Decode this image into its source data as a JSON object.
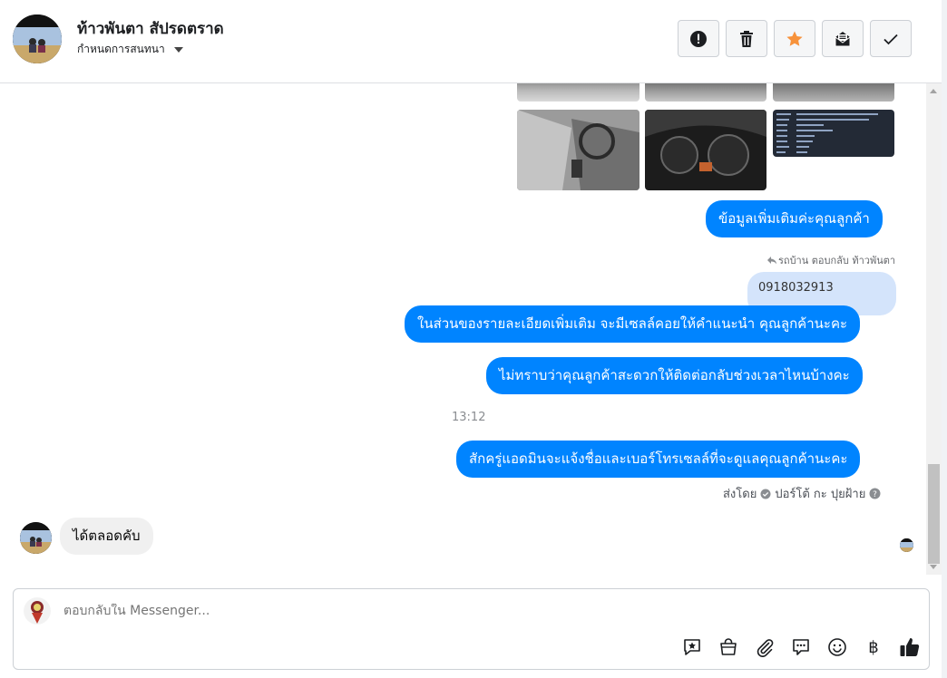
{
  "header": {
    "contact_name": "ท้าวพันตา สัปรดตราด",
    "assign_label": "กำหนดการสนทนา",
    "actions": [
      {
        "name": "mark-spam",
        "icon": "alert-circle-icon"
      },
      {
        "name": "delete",
        "icon": "trash-icon"
      },
      {
        "name": "star",
        "icon": "star-icon"
      },
      {
        "name": "mark-unread",
        "icon": "envelope-open-icon"
      },
      {
        "name": "mark-done",
        "icon": "checkmark-icon"
      }
    ]
  },
  "conversation": {
    "more_info": "ข้อมูลเพิ่มเติมค่ะคุณลูกค้า",
    "reply_note": "รถบ้าน ตอบกลับ ท้าวพันตา",
    "quoted_text": "0918032913",
    "msg_details": "ในส่วนของรายละเอียดเพิ่มเติม จะมีเซลล์คอยให้คำแนะนำ คุณลูกค้านะคะ",
    "msg_ask_time": "ไม่ทราบว่าคุณลูกค้าสะดวกให้ติดต่อกลับช่วงเวลาไหนบ้างคะ",
    "timestamp": "13:12",
    "msg_admin": "สักครู่แอดมินจะแจ้งชื่อและเบอร์โทรเซลล์ที่จะดูแลคุณลูกค้านะคะ",
    "sent_by_label": "ส่งโดย",
    "sent_by_name": "ปอร์โต้ กะ ปุยฝ้าย",
    "incoming_msg": "ได้ตลอดคับ"
  },
  "composer": {
    "placeholder": "ตอบกลับใน Messenger...",
    "tools": [
      "saved-reply-icon",
      "shop-bag-icon",
      "paperclip-icon",
      "chat-bubbles-icon",
      "emoji-icon",
      "baht-icon",
      "thumbs-up-icon"
    ]
  },
  "colors": {
    "accent": "#0084ff",
    "quoted_bg": "#d4e4fb",
    "star": "#f7923b"
  }
}
